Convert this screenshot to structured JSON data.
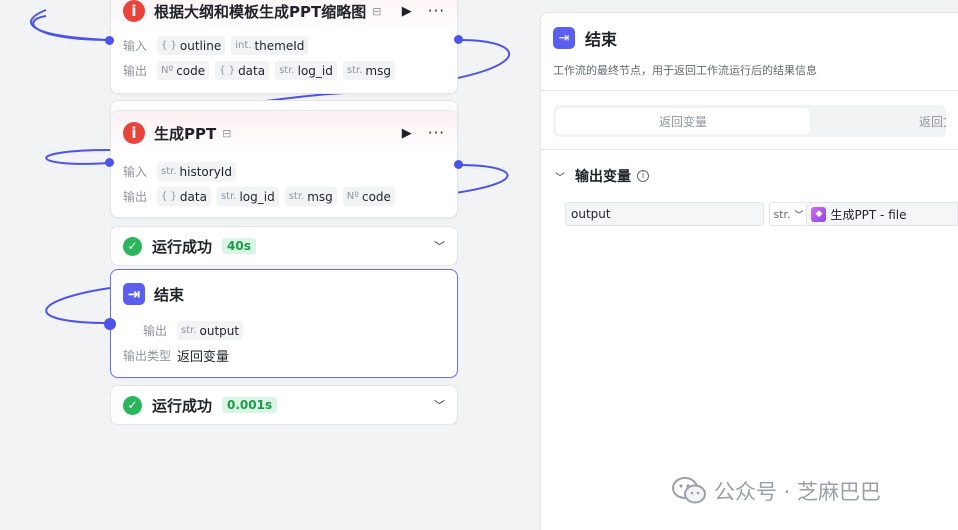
{
  "nodes": {
    "thumbnail": {
      "title": "根据大纲和模板生成PPT缩略图",
      "input_label": "输入",
      "inputs": [
        {
          "type": "{ }",
          "name": "outline"
        },
        {
          "type": "int.",
          "name": "themeId"
        }
      ],
      "output_label": "输出",
      "outputs": [
        {
          "type": "Nº",
          "name": "code"
        },
        {
          "type": "{ }",
          "name": "data"
        },
        {
          "type": "str.",
          "name": "log_id"
        },
        {
          "type": "str.",
          "name": "msg"
        }
      ]
    },
    "gen_ppt": {
      "title": "生成PPT",
      "input_label": "输入",
      "inputs": [
        {
          "type": "str.",
          "name": "historyId"
        }
      ],
      "output_label": "输出",
      "outputs": [
        {
          "type": "{ }",
          "name": "data"
        },
        {
          "type": "str.",
          "name": "log_id"
        },
        {
          "type": "str.",
          "name": "msg"
        },
        {
          "type": "Nº",
          "name": "code"
        }
      ]
    },
    "gen_ppt_status": {
      "text": "运行成功",
      "time": "40s"
    },
    "end": {
      "title": "结束",
      "output_label": "输出",
      "outputs": [
        {
          "type": "str.",
          "name": "output"
        }
      ],
      "output_type_label": "输出类型",
      "output_type_value": "返回变量"
    },
    "end_status": {
      "text": "运行成功",
      "time": "0.001s"
    }
  },
  "panel": {
    "title": "结束",
    "description": "工作流的最终节点，用于返回工作流运行后的结果信息",
    "tabs": {
      "active": "返回变量",
      "other": "返回文本"
    },
    "section_title": "输出变量",
    "variable": {
      "name": "output",
      "type": "str.",
      "ref": "生成PPT - file"
    }
  },
  "watermark": {
    "text": "公众号 · 芝麻巴巴"
  },
  "colors": {
    "accent": "#4d53e8",
    "success": "#2bb55c",
    "node_icon": "#e8443c",
    "end_icon": "#5b5ff0"
  }
}
